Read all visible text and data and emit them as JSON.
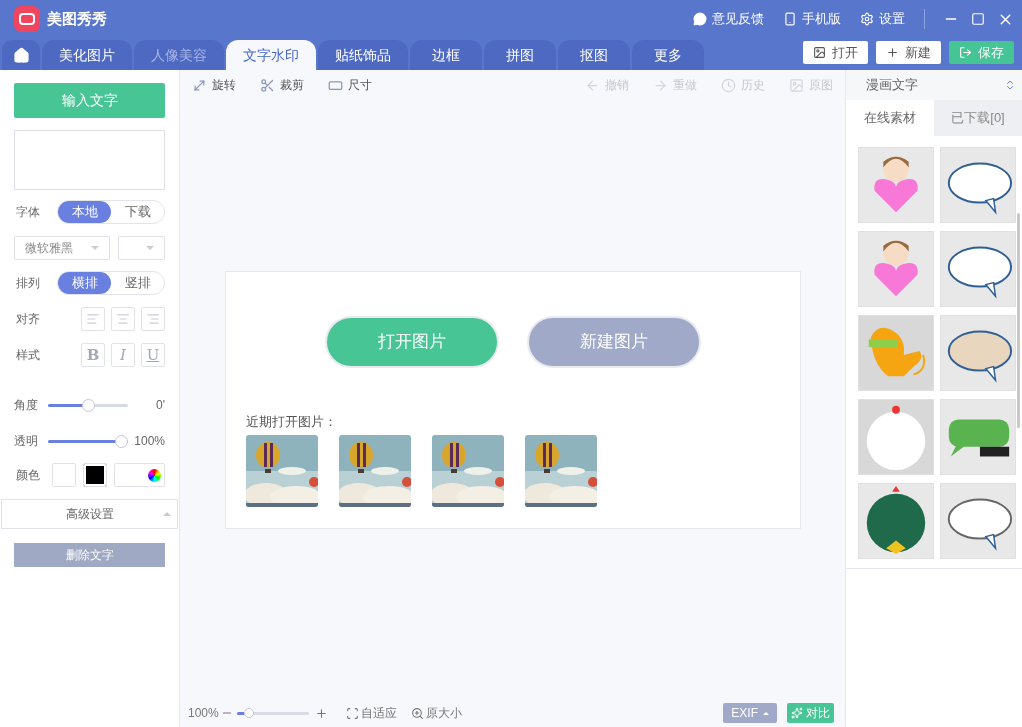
{
  "app": {
    "title": "美图秀秀"
  },
  "header_links": [
    {
      "label": "意见反馈",
      "kind": "feedback"
    },
    {
      "label": "手机版",
      "kind": "phone"
    },
    {
      "label": "设置",
      "kind": "settings"
    }
  ],
  "tabs": [
    {
      "label": "美化图片",
      "selected": false,
      "disabled": false
    },
    {
      "label": "人像美容",
      "selected": false,
      "disabled": true
    },
    {
      "label": "文字水印",
      "selected": true,
      "disabled": false
    },
    {
      "label": "贴纸饰品",
      "selected": false,
      "disabled": false
    },
    {
      "label": "边框",
      "selected": false,
      "disabled": false
    },
    {
      "label": "拼图",
      "selected": false,
      "disabled": false
    },
    {
      "label": "抠图",
      "selected": false,
      "disabled": false
    },
    {
      "label": "更多",
      "selected": false,
      "disabled": false
    }
  ],
  "actions": [
    {
      "label": "打开",
      "kind": "open"
    },
    {
      "label": "新建",
      "kind": "new"
    },
    {
      "label": "保存",
      "kind": "save"
    }
  ],
  "left_panel": {
    "input_button": "输入文字",
    "font": {
      "label": "字体",
      "options": [
        {
          "label": "本地",
          "selected": true
        },
        {
          "label": "下载",
          "selected": false
        }
      ],
      "family": "微软雅黑"
    },
    "arrange": {
      "label": "排列",
      "options": [
        {
          "label": "横排",
          "selected": true
        },
        {
          "label": "竖排",
          "selected": false
        }
      ]
    },
    "align": {
      "label": "对齐",
      "options": [
        {
          "kind": "left"
        },
        {
          "kind": "center"
        },
        {
          "kind": "right"
        }
      ]
    },
    "style": {
      "label": "样式",
      "options": [
        {
          "label": "B",
          "kind": "bold"
        },
        {
          "label": "I",
          "kind": "italic"
        },
        {
          "label": "U",
          "kind": "underline"
        }
      ]
    },
    "sliders": [
      {
        "label": "角度",
        "level": 0.5,
        "reading": "0'"
      },
      {
        "label": "透明",
        "level": 1,
        "reading": "100%"
      }
    ],
    "color": {
      "label": "颜色",
      "swatches": [
        {
          "color": "#ffffff"
        },
        {
          "color": "#000000"
        }
      ]
    },
    "advanced": "高级设置",
    "delete_button": "删除文字"
  },
  "toolbar": [
    {
      "label": "旋转",
      "kind": "rotate",
      "disabled": false
    },
    {
      "label": "裁剪",
      "kind": "crop",
      "disabled": false
    },
    {
      "label": "尺寸",
      "kind": "size",
      "disabled": false
    },
    {
      "label": "撤销",
      "kind": "undo",
      "disabled": true
    },
    {
      "label": "重做",
      "kind": "redo",
      "disabled": true
    },
    {
      "label": "历史",
      "kind": "history",
      "disabled": true
    },
    {
      "label": "原图",
      "kind": "original",
      "disabled": true
    }
  ],
  "canvas": {
    "open_button": "打开图片",
    "new_button": "新建图片",
    "recent_label": "近期打开图片："
  },
  "right_panel": {
    "category": "漫画文字",
    "tabs": [
      {
        "label": "在线素材",
        "selected": true
      },
      {
        "label": "已下载[0]",
        "selected": false
      }
    ]
  },
  "status_bar": {
    "zoom": "100%",
    "zoom_level": {
      "level": 0.12
    },
    "fit": "自适应",
    "actual_size": "原大小",
    "exif": "EXIF",
    "compare": "对比"
  }
}
